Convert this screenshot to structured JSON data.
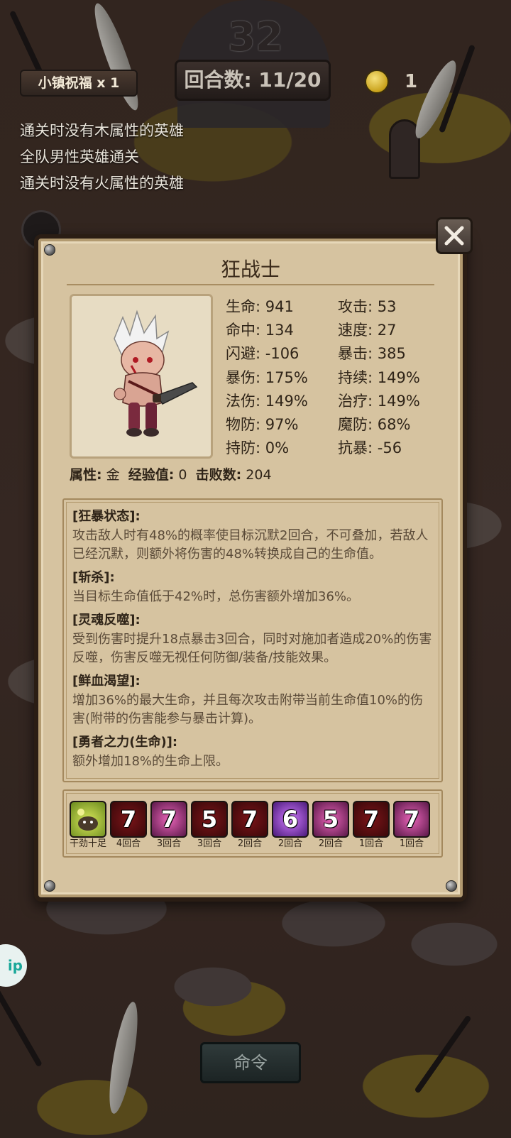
{
  "hud": {
    "big_number": "32",
    "blessing": "小镇祝福 x 1",
    "round": "回合数: 11/20",
    "coins": "1",
    "conditions": [
      "通关时没有木属性的英雄",
      "全队男性英雄通关",
      "通关时没有火属性的英雄"
    ],
    "command_label": "命令",
    "side_button_text": "ip"
  },
  "hero": {
    "name": "狂战士",
    "stats": [
      [
        "生命: 941",
        "攻击: 53"
      ],
      [
        "命中: 134",
        "速度: 27"
      ],
      [
        "闪避: -106",
        "暴击: 385"
      ],
      [
        "暴伤: 175%",
        "持续: 149%"
      ],
      [
        "法伤: 149%",
        "治疗: 149%"
      ],
      [
        "物防: 97%",
        "魔防: 68%"
      ],
      [
        "持防: 0%",
        "抗暴: -56"
      ]
    ],
    "attr_label": "属性:",
    "attr_value": "金",
    "exp_label": "经验值:",
    "exp_value": "0",
    "kills_label": "击败数:",
    "kills_value": "204"
  },
  "skills": [
    {
      "name": "[狂暴状态]:",
      "desc": "攻击敌人时有48%的概率使目标沉默2回合，不可叠加，若敌人已经沉默，则额外将伤害的48%转换成自己的生命值。"
    },
    {
      "name": "[斩杀]:",
      "desc": "当目标生命值低于42%时，总伤害额外增加36%。"
    },
    {
      "name": "[灵魂反噬]:",
      "desc": "受到伤害时提升18点暴击3回合，同时对施加者造成20%的伤害反噬，伤害反噬无视任何防御/装备/技能效果。"
    },
    {
      "name": "[鲜血渴望]:",
      "desc": "增加36%的最大生命，并且每次攻击附带当前生命值10%的伤害(附带的伤害能参与暴击计算)。"
    },
    {
      "name": "[勇者之力(生命)]:",
      "desc": "额外增加18%的生命上限。"
    }
  ],
  "buffs": [
    {
      "num": "",
      "label": "干劲十足",
      "style": "green",
      "icon": "blob-face-icon"
    },
    {
      "num": "7",
      "label": "4回合",
      "style": "red",
      "icon": "slash-icon"
    },
    {
      "num": "7",
      "label": "3回合",
      "style": "pink",
      "icon": "claw-icon"
    },
    {
      "num": "5",
      "label": "3回合",
      "style": "red",
      "icon": "slash-icon"
    },
    {
      "num": "7",
      "label": "2回合",
      "style": "red",
      "icon": "slash-icon"
    },
    {
      "num": "6",
      "label": "2回合",
      "style": "purple",
      "icon": "vortex-icon"
    },
    {
      "num": "5",
      "label": "2回合",
      "style": "pink",
      "icon": "claw-icon"
    },
    {
      "num": "7",
      "label": "1回合",
      "style": "red",
      "icon": "slash-icon"
    },
    {
      "num": "7",
      "label": "1回合",
      "style": "pink",
      "icon": "claw-icon"
    }
  ]
}
